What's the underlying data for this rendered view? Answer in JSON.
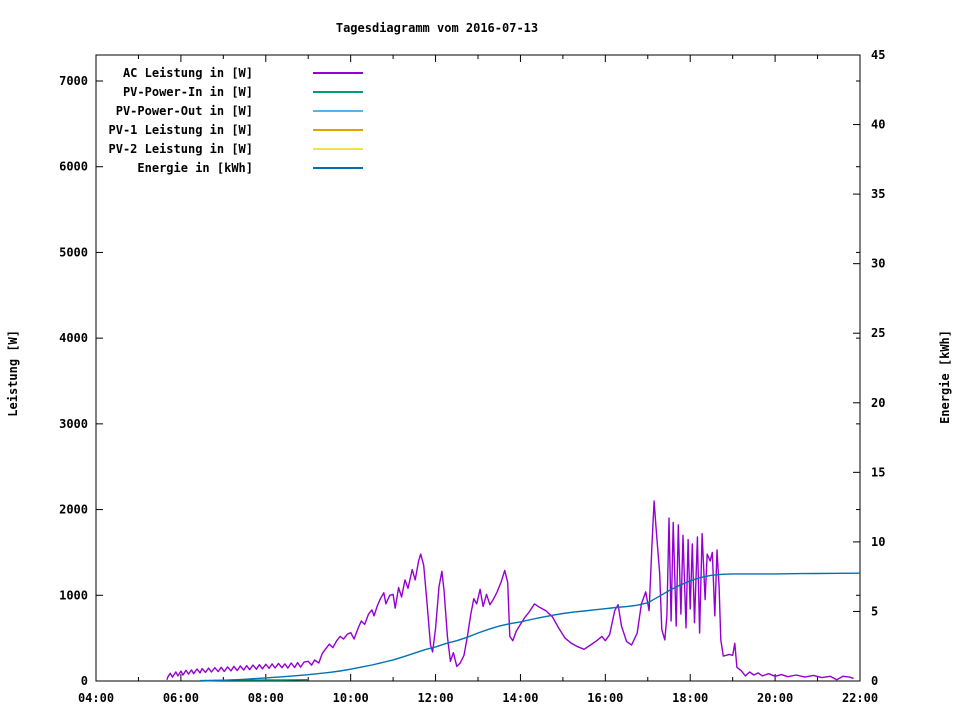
{
  "chart_data": {
    "type": "line",
    "title": "Tagesdiagramm vom 2016-07-13",
    "ylabel_left": "Leistung [W]",
    "ylabel_right": "Energie [kWh]",
    "legend_position": "top-left-inside",
    "grid": false,
    "x_axis": {
      "unit": "time",
      "range_hours": [
        4,
        22
      ],
      "major_tick_every_hours": 2,
      "minor_tick_every_hours": 1,
      "tick_labels": [
        "04:00",
        "06:00",
        "08:00",
        "10:00",
        "12:00",
        "14:00",
        "16:00",
        "18:00",
        "20:00",
        "22:00"
      ]
    },
    "y_left_axis": {
      "label": "Leistung [W]",
      "range": [
        0,
        7350
      ],
      "ticks": [
        0,
        1000,
        2000,
        3000,
        4000,
        5000,
        6000,
        7000
      ],
      "tick_labels": [
        "0",
        "1000",
        "2000",
        "3000",
        "4000",
        "5000",
        "6000",
        "7000"
      ]
    },
    "y_right_axis": {
      "label": "Energie [kWh]",
      "range": [
        0,
        45
      ],
      "ticks": [
        0,
        5,
        10,
        15,
        20,
        25,
        30,
        35,
        40,
        45
      ],
      "tick_labels": [
        "0",
        "5",
        "10",
        "15",
        "20",
        "25",
        "30",
        "35",
        "40",
        "45"
      ]
    },
    "series": [
      {
        "name": "AC Leistung in [W]",
        "color": "#9400d3",
        "axis": "left",
        "points": [
          [
            5.67,
            15
          ],
          [
            5.7,
            55
          ],
          [
            5.75,
            90
          ],
          [
            5.8,
            45
          ],
          [
            5.88,
            105
          ],
          [
            5.93,
            60
          ],
          [
            6.0,
            115
          ],
          [
            6.05,
            70
          ],
          [
            6.12,
            125
          ],
          [
            6.18,
            80
          ],
          [
            6.25,
            130
          ],
          [
            6.3,
            85
          ],
          [
            6.38,
            140
          ],
          [
            6.45,
            95
          ],
          [
            6.5,
            145
          ],
          [
            6.58,
            100
          ],
          [
            6.65,
            150
          ],
          [
            6.72,
            105
          ],
          [
            6.8,
            155
          ],
          [
            6.88,
            110
          ],
          [
            6.95,
            160
          ],
          [
            7.02,
            112
          ],
          [
            7.1,
            165
          ],
          [
            7.18,
            118
          ],
          [
            7.25,
            170
          ],
          [
            7.33,
            122
          ],
          [
            7.4,
            175
          ],
          [
            7.48,
            128
          ],
          [
            7.55,
            180
          ],
          [
            7.62,
            132
          ],
          [
            7.7,
            185
          ],
          [
            7.78,
            138
          ],
          [
            7.85,
            190
          ],
          [
            7.92,
            142
          ],
          [
            8.0,
            195
          ],
          [
            8.08,
            148
          ],
          [
            8.15,
            200
          ],
          [
            8.22,
            152
          ],
          [
            8.3,
            205
          ],
          [
            8.38,
            155
          ],
          [
            8.45,
            200
          ],
          [
            8.52,
            150
          ],
          [
            8.6,
            210
          ],
          [
            8.68,
            158
          ],
          [
            8.75,
            215
          ],
          [
            8.82,
            162
          ],
          [
            8.9,
            220
          ],
          [
            9.0,
            230
          ],
          [
            9.08,
            185
          ],
          [
            9.15,
            245
          ],
          [
            9.25,
            210
          ],
          [
            9.33,
            320
          ],
          [
            9.42,
            380
          ],
          [
            9.5,
            430
          ],
          [
            9.58,
            390
          ],
          [
            9.67,
            470
          ],
          [
            9.75,
            520
          ],
          [
            9.83,
            490
          ],
          [
            9.92,
            545
          ],
          [
            10.0,
            565
          ],
          [
            10.08,
            490
          ],
          [
            10.17,
            610
          ],
          [
            10.25,
            700
          ],
          [
            10.33,
            660
          ],
          [
            10.42,
            780
          ],
          [
            10.5,
            830
          ],
          [
            10.55,
            760
          ],
          [
            10.63,
            880
          ],
          [
            10.7,
            960
          ],
          [
            10.78,
            1030
          ],
          [
            10.83,
            900
          ],
          [
            10.92,
            1000
          ],
          [
            11.0,
            1010
          ],
          [
            11.05,
            850
          ],
          [
            11.13,
            1090
          ],
          [
            11.2,
            980
          ],
          [
            11.28,
            1180
          ],
          [
            11.35,
            1080
          ],
          [
            11.45,
            1300
          ],
          [
            11.52,
            1180
          ],
          [
            11.6,
            1400
          ],
          [
            11.65,
            1480
          ],
          [
            11.72,
            1350
          ],
          [
            11.8,
            900
          ],
          [
            11.88,
            420
          ],
          [
            11.93,
            340
          ],
          [
            12.0,
            620
          ],
          [
            12.08,
            1100
          ],
          [
            12.15,
            1280
          ],
          [
            12.2,
            1060
          ],
          [
            12.28,
            520
          ],
          [
            12.35,
            230
          ],
          [
            12.42,
            330
          ],
          [
            12.5,
            170
          ],
          [
            12.58,
            210
          ],
          [
            12.67,
            300
          ],
          [
            12.75,
            520
          ],
          [
            12.83,
            780
          ],
          [
            12.9,
            960
          ],
          [
            12.97,
            900
          ],
          [
            13.05,
            1070
          ],
          [
            13.12,
            870
          ],
          [
            13.2,
            1010
          ],
          [
            13.28,
            890
          ],
          [
            13.37,
            960
          ],
          [
            13.45,
            1040
          ],
          [
            13.55,
            1160
          ],
          [
            13.63,
            1290
          ],
          [
            13.7,
            1150
          ],
          [
            13.75,
            520
          ],
          [
            13.82,
            470
          ],
          [
            13.9,
            580
          ],
          [
            14.0,
            660
          ],
          [
            14.1,
            740
          ],
          [
            14.2,
            800
          ],
          [
            14.33,
            900
          ],
          [
            14.45,
            860
          ],
          [
            14.6,
            820
          ],
          [
            14.75,
            750
          ],
          [
            14.9,
            620
          ],
          [
            15.05,
            500
          ],
          [
            15.2,
            440
          ],
          [
            15.35,
            400
          ],
          [
            15.5,
            370
          ],
          [
            15.65,
            420
          ],
          [
            15.8,
            470
          ],
          [
            15.92,
            520
          ],
          [
            16.0,
            470
          ],
          [
            16.1,
            540
          ],
          [
            16.22,
            820
          ],
          [
            16.3,
            890
          ],
          [
            16.38,
            640
          ],
          [
            16.5,
            460
          ],
          [
            16.62,
            420
          ],
          [
            16.75,
            560
          ],
          [
            16.85,
            900
          ],
          [
            16.95,
            1040
          ],
          [
            17.03,
            820
          ],
          [
            17.1,
            1600
          ],
          [
            17.15,
            2100
          ],
          [
            17.2,
            1750
          ],
          [
            17.28,
            1250
          ],
          [
            17.33,
            600
          ],
          [
            17.4,
            480
          ],
          [
            17.45,
            760
          ],
          [
            17.5,
            1900
          ],
          [
            17.55,
            700
          ],
          [
            17.6,
            1850
          ],
          [
            17.67,
            640
          ],
          [
            17.72,
            1820
          ],
          [
            17.78,
            780
          ],
          [
            17.83,
            1700
          ],
          [
            17.9,
            620
          ],
          [
            17.95,
            1650
          ],
          [
            18.0,
            840
          ],
          [
            18.05,
            1600
          ],
          [
            18.1,
            680
          ],
          [
            18.17,
            1680
          ],
          [
            18.22,
            560
          ],
          [
            18.28,
            1720
          ],
          [
            18.35,
            950
          ],
          [
            18.4,
            1480
          ],
          [
            18.47,
            1400
          ],
          [
            18.52,
            1500
          ],
          [
            18.58,
            760
          ],
          [
            18.63,
            1530
          ],
          [
            18.68,
            1100
          ],
          [
            18.72,
            480
          ],
          [
            18.78,
            290
          ],
          [
            18.85,
            300
          ],
          [
            18.92,
            310
          ],
          [
            19.0,
            300
          ],
          [
            19.05,
            440
          ],
          [
            19.1,
            160
          ],
          [
            19.2,
            120
          ],
          [
            19.3,
            60
          ],
          [
            19.4,
            105
          ],
          [
            19.5,
            70
          ],
          [
            19.6,
            95
          ],
          [
            19.7,
            60
          ],
          [
            19.85,
            85
          ],
          [
            20.0,
            55
          ],
          [
            20.15,
            75
          ],
          [
            20.3,
            50
          ],
          [
            20.5,
            70
          ],
          [
            20.7,
            45
          ],
          [
            20.9,
            65
          ],
          [
            21.1,
            40
          ],
          [
            21.3,
            55
          ],
          [
            21.45,
            15
          ],
          [
            21.6,
            55
          ],
          [
            21.75,
            45
          ],
          [
            21.85,
            30
          ]
        ]
      },
      {
        "name": "PV-Power-In in [W]",
        "color": "#009e73",
        "axis": "left",
        "points": [
          [
            6.45,
            5
          ],
          [
            6.8,
            8
          ],
          [
            7.2,
            10
          ],
          [
            7.6,
            10
          ],
          [
            8.0,
            12
          ],
          [
            8.4,
            12
          ],
          [
            8.7,
            14
          ],
          [
            9.0,
            15
          ]
        ]
      },
      {
        "name": "PV-Power-Out in [W]",
        "color": "#56b4e9",
        "axis": "left",
        "points": []
      },
      {
        "name": "PV-1 Leistung in [W]",
        "color": "#e69f00",
        "axis": "left",
        "points": []
      },
      {
        "name": "PV-2 Leistung in [W]",
        "color": "#f0e442",
        "axis": "left",
        "points": []
      },
      {
        "name": "Energie in [kWh]",
        "color": "#0072b2",
        "axis": "right",
        "points": [
          [
            6.45,
            0.0
          ],
          [
            7.0,
            0.05
          ],
          [
            7.5,
            0.12
          ],
          [
            8.0,
            0.22
          ],
          [
            8.5,
            0.33
          ],
          [
            9.0,
            0.45
          ],
          [
            9.5,
            0.62
          ],
          [
            9.75,
            0.72
          ],
          [
            10.0,
            0.85
          ],
          [
            10.25,
            1.0
          ],
          [
            10.5,
            1.15
          ],
          [
            10.75,
            1.33
          ],
          [
            11.0,
            1.52
          ],
          [
            11.25,
            1.75
          ],
          [
            11.5,
            2.0
          ],
          [
            11.75,
            2.25
          ],
          [
            12.0,
            2.45
          ],
          [
            12.25,
            2.7
          ],
          [
            12.5,
            2.9
          ],
          [
            12.75,
            3.15
          ],
          [
            13.0,
            3.45
          ],
          [
            13.25,
            3.72
          ],
          [
            13.5,
            3.95
          ],
          [
            13.75,
            4.12
          ],
          [
            14.0,
            4.25
          ],
          [
            14.25,
            4.42
          ],
          [
            14.5,
            4.58
          ],
          [
            14.75,
            4.72
          ],
          [
            15.0,
            4.85
          ],
          [
            15.25,
            4.95
          ],
          [
            15.5,
            5.03
          ],
          [
            15.75,
            5.12
          ],
          [
            16.0,
            5.2
          ],
          [
            16.25,
            5.28
          ],
          [
            16.5,
            5.35
          ],
          [
            16.75,
            5.45
          ],
          [
            17.0,
            5.62
          ],
          [
            17.25,
            6.05
          ],
          [
            17.5,
            6.5
          ],
          [
            17.75,
            6.88
          ],
          [
            18.0,
            7.2
          ],
          [
            18.25,
            7.45
          ],
          [
            18.5,
            7.6
          ],
          [
            18.75,
            7.67
          ],
          [
            19.0,
            7.7
          ],
          [
            19.5,
            7.7
          ],
          [
            20.0,
            7.7
          ],
          [
            20.6,
            7.72
          ],
          [
            21.0,
            7.73
          ],
          [
            21.5,
            7.74
          ],
          [
            22.0,
            7.75
          ]
        ]
      }
    ]
  }
}
